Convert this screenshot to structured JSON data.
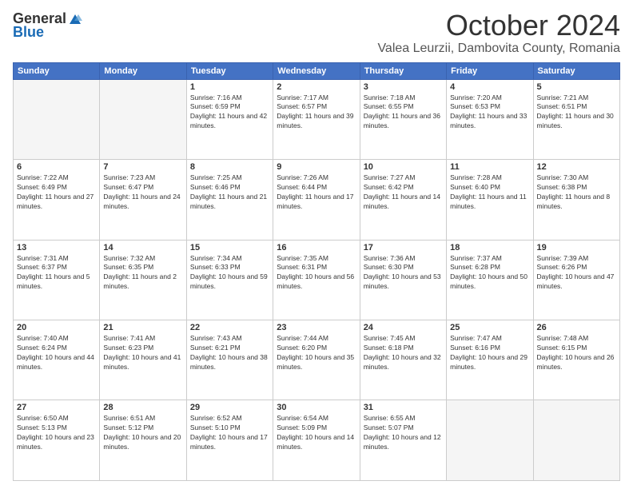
{
  "header": {
    "logo_general": "General",
    "logo_blue": "Blue",
    "month_title": "October 2024",
    "location": "Valea Leurzii, Dambovita County, Romania"
  },
  "days_of_week": [
    "Sunday",
    "Monday",
    "Tuesday",
    "Wednesday",
    "Thursday",
    "Friday",
    "Saturday"
  ],
  "weeks": [
    [
      {
        "day": "",
        "sunrise": "",
        "sunset": "",
        "daylight": ""
      },
      {
        "day": "",
        "sunrise": "",
        "sunset": "",
        "daylight": ""
      },
      {
        "day": "1",
        "sunrise": "Sunrise: 7:16 AM",
        "sunset": "Sunset: 6:59 PM",
        "daylight": "Daylight: 11 hours and 42 minutes."
      },
      {
        "day": "2",
        "sunrise": "Sunrise: 7:17 AM",
        "sunset": "Sunset: 6:57 PM",
        "daylight": "Daylight: 11 hours and 39 minutes."
      },
      {
        "day": "3",
        "sunrise": "Sunrise: 7:18 AM",
        "sunset": "Sunset: 6:55 PM",
        "daylight": "Daylight: 11 hours and 36 minutes."
      },
      {
        "day": "4",
        "sunrise": "Sunrise: 7:20 AM",
        "sunset": "Sunset: 6:53 PM",
        "daylight": "Daylight: 11 hours and 33 minutes."
      },
      {
        "day": "5",
        "sunrise": "Sunrise: 7:21 AM",
        "sunset": "Sunset: 6:51 PM",
        "daylight": "Daylight: 11 hours and 30 minutes."
      }
    ],
    [
      {
        "day": "6",
        "sunrise": "Sunrise: 7:22 AM",
        "sunset": "Sunset: 6:49 PM",
        "daylight": "Daylight: 11 hours and 27 minutes."
      },
      {
        "day": "7",
        "sunrise": "Sunrise: 7:23 AM",
        "sunset": "Sunset: 6:47 PM",
        "daylight": "Daylight: 11 hours and 24 minutes."
      },
      {
        "day": "8",
        "sunrise": "Sunrise: 7:25 AM",
        "sunset": "Sunset: 6:46 PM",
        "daylight": "Daylight: 11 hours and 21 minutes."
      },
      {
        "day": "9",
        "sunrise": "Sunrise: 7:26 AM",
        "sunset": "Sunset: 6:44 PM",
        "daylight": "Daylight: 11 hours and 17 minutes."
      },
      {
        "day": "10",
        "sunrise": "Sunrise: 7:27 AM",
        "sunset": "Sunset: 6:42 PM",
        "daylight": "Daylight: 11 hours and 14 minutes."
      },
      {
        "day": "11",
        "sunrise": "Sunrise: 7:28 AM",
        "sunset": "Sunset: 6:40 PM",
        "daylight": "Daylight: 11 hours and 11 minutes."
      },
      {
        "day": "12",
        "sunrise": "Sunrise: 7:30 AM",
        "sunset": "Sunset: 6:38 PM",
        "daylight": "Daylight: 11 hours and 8 minutes."
      }
    ],
    [
      {
        "day": "13",
        "sunrise": "Sunrise: 7:31 AM",
        "sunset": "Sunset: 6:37 PM",
        "daylight": "Daylight: 11 hours and 5 minutes."
      },
      {
        "day": "14",
        "sunrise": "Sunrise: 7:32 AM",
        "sunset": "Sunset: 6:35 PM",
        "daylight": "Daylight: 11 hours and 2 minutes."
      },
      {
        "day": "15",
        "sunrise": "Sunrise: 7:34 AM",
        "sunset": "Sunset: 6:33 PM",
        "daylight": "Daylight: 10 hours and 59 minutes."
      },
      {
        "day": "16",
        "sunrise": "Sunrise: 7:35 AM",
        "sunset": "Sunset: 6:31 PM",
        "daylight": "Daylight: 10 hours and 56 minutes."
      },
      {
        "day": "17",
        "sunrise": "Sunrise: 7:36 AM",
        "sunset": "Sunset: 6:30 PM",
        "daylight": "Daylight: 10 hours and 53 minutes."
      },
      {
        "day": "18",
        "sunrise": "Sunrise: 7:37 AM",
        "sunset": "Sunset: 6:28 PM",
        "daylight": "Daylight: 10 hours and 50 minutes."
      },
      {
        "day": "19",
        "sunrise": "Sunrise: 7:39 AM",
        "sunset": "Sunset: 6:26 PM",
        "daylight": "Daylight: 10 hours and 47 minutes."
      }
    ],
    [
      {
        "day": "20",
        "sunrise": "Sunrise: 7:40 AM",
        "sunset": "Sunset: 6:24 PM",
        "daylight": "Daylight: 10 hours and 44 minutes."
      },
      {
        "day": "21",
        "sunrise": "Sunrise: 7:41 AM",
        "sunset": "Sunset: 6:23 PM",
        "daylight": "Daylight: 10 hours and 41 minutes."
      },
      {
        "day": "22",
        "sunrise": "Sunrise: 7:43 AM",
        "sunset": "Sunset: 6:21 PM",
        "daylight": "Daylight: 10 hours and 38 minutes."
      },
      {
        "day": "23",
        "sunrise": "Sunrise: 7:44 AM",
        "sunset": "Sunset: 6:20 PM",
        "daylight": "Daylight: 10 hours and 35 minutes."
      },
      {
        "day": "24",
        "sunrise": "Sunrise: 7:45 AM",
        "sunset": "Sunset: 6:18 PM",
        "daylight": "Daylight: 10 hours and 32 minutes."
      },
      {
        "day": "25",
        "sunrise": "Sunrise: 7:47 AM",
        "sunset": "Sunset: 6:16 PM",
        "daylight": "Daylight: 10 hours and 29 minutes."
      },
      {
        "day": "26",
        "sunrise": "Sunrise: 7:48 AM",
        "sunset": "Sunset: 6:15 PM",
        "daylight": "Daylight: 10 hours and 26 minutes."
      }
    ],
    [
      {
        "day": "27",
        "sunrise": "Sunrise: 6:50 AM",
        "sunset": "Sunset: 5:13 PM",
        "daylight": "Daylight: 10 hours and 23 minutes."
      },
      {
        "day": "28",
        "sunrise": "Sunrise: 6:51 AM",
        "sunset": "Sunset: 5:12 PM",
        "daylight": "Daylight: 10 hours and 20 minutes."
      },
      {
        "day": "29",
        "sunrise": "Sunrise: 6:52 AM",
        "sunset": "Sunset: 5:10 PM",
        "daylight": "Daylight: 10 hours and 17 minutes."
      },
      {
        "day": "30",
        "sunrise": "Sunrise: 6:54 AM",
        "sunset": "Sunset: 5:09 PM",
        "daylight": "Daylight: 10 hours and 14 minutes."
      },
      {
        "day": "31",
        "sunrise": "Sunrise: 6:55 AM",
        "sunset": "Sunset: 5:07 PM",
        "daylight": "Daylight: 10 hours and 12 minutes."
      },
      {
        "day": "",
        "sunrise": "",
        "sunset": "",
        "daylight": ""
      },
      {
        "day": "",
        "sunrise": "",
        "sunset": "",
        "daylight": ""
      }
    ]
  ]
}
